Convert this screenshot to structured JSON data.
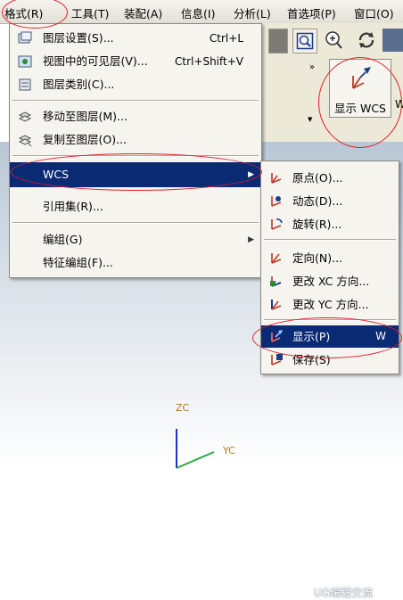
{
  "menubar": {
    "items": [
      {
        "label": "格式(R)",
        "name": "menu-format"
      },
      {
        "label": "工具(T)",
        "name": "menu-tools"
      },
      {
        "label": "装配(A)",
        "name": "menu-assembly"
      },
      {
        "label": "信息(I)",
        "name": "menu-info"
      },
      {
        "label": "分析(L)",
        "name": "menu-analysis"
      },
      {
        "label": "首选项(P)",
        "name": "menu-preferences"
      },
      {
        "label": "窗口(O)",
        "name": "menu-window"
      }
    ]
  },
  "format_menu": {
    "items": [
      {
        "label": "图层设置(S)...",
        "shortcut": "Ctrl+L"
      },
      {
        "label": "视图中的可见层(V)...",
        "shortcut": "Ctrl+Shift+V"
      },
      {
        "label": "图层类别(C)...",
        "shortcut": ""
      },
      {
        "label": "移动至图层(M)...",
        "shortcut": ""
      },
      {
        "label": "复制至图层(O)...",
        "shortcut": ""
      },
      {
        "label": "WCS",
        "shortcut": ""
      },
      {
        "label": "引用集(R)...",
        "shortcut": ""
      },
      {
        "label": "编组(G)",
        "shortcut": ""
      },
      {
        "label": "特征编组(F)...",
        "shortcut": ""
      }
    ]
  },
  "wcs_submenu": {
    "items": [
      {
        "label": "原点(O)...",
        "shortcut": ""
      },
      {
        "label": "动态(D)...",
        "shortcut": ""
      },
      {
        "label": "旋转(R)...",
        "shortcut": ""
      },
      {
        "label": "定向(N)...",
        "shortcut": ""
      },
      {
        "label": "更改 XC 方向...",
        "shortcut": ""
      },
      {
        "label": "更改 YC 方向...",
        "shortcut": ""
      },
      {
        "label": "显示(P)",
        "shortcut": "W"
      },
      {
        "label": "保存(S)",
        "shortcut": ""
      }
    ]
  },
  "toolbar": {
    "show_wcs_label": "显示 WCS",
    "edge_label": "W"
  },
  "viewport": {
    "axis_zc": "ZC",
    "axis_yc": "YC"
  },
  "watermark": {
    "text": "UG编程交流"
  },
  "colors": {
    "selection": "#0a2a73",
    "annotation": "#e0202a",
    "menu_bg": "#f5f4ef"
  }
}
